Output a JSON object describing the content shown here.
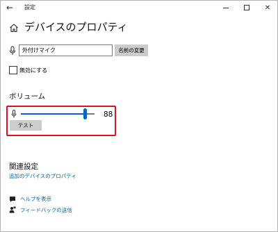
{
  "window": {
    "title": "設定",
    "back_glyph": "←",
    "close_glyph": "✕"
  },
  "page": {
    "title": "デバイスのプロパティ"
  },
  "device": {
    "name_value": "外付けマイク",
    "rename_label": "名前の変更",
    "disable_label": "無効にする",
    "disable_checked": false
  },
  "volume": {
    "section_title": "ボリューム",
    "value_text": "88",
    "level": 88,
    "test_label": "テスト"
  },
  "related": {
    "section_title": "関連設定",
    "link_label": "追加のデバイスのプロパティ"
  },
  "help": {
    "help_label": "ヘルプを表示",
    "feedback_label": "フィードバックの送信"
  },
  "colors": {
    "accent": "#0a64c8",
    "link": "#0063b1",
    "highlight": "#e0101e",
    "button_bg": "#cccccc"
  },
  "icons": {
    "back": "back-arrow-icon",
    "home": "home-icon",
    "microphone": "microphone-icon",
    "help": "help-chat-icon",
    "feedback": "feedback-person-icon"
  }
}
